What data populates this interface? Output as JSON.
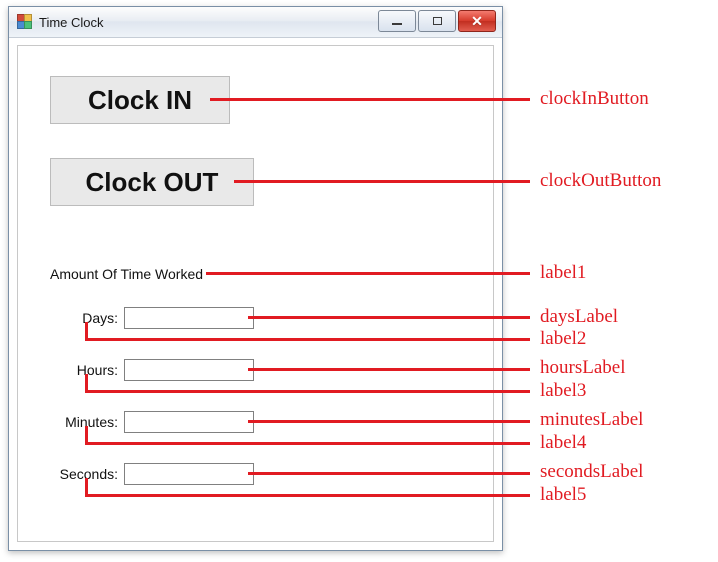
{
  "window": {
    "title": "Time Clock"
  },
  "buttons": {
    "clock_in": "Clock IN",
    "clock_out": "Clock OUT"
  },
  "section": {
    "amount_label": "Amount Of Time Worked"
  },
  "rows": {
    "days": {
      "label": "Days:",
      "value": ""
    },
    "hours": {
      "label": "Hours:",
      "value": ""
    },
    "minutes": {
      "label": "Minutes:",
      "value": ""
    },
    "seconds": {
      "label": "Seconds:",
      "value": ""
    }
  },
  "annotations": {
    "clockInButton": "clockInButton",
    "clockOutButton": "clockOutButton",
    "label1": "label1",
    "daysLabel": "daysLabel",
    "label2": "label2",
    "hoursLabel": "hoursLabel",
    "label3": "label3",
    "minutesLabel": "minutesLabel",
    "label4": "label4",
    "secondsLabel": "secondsLabel",
    "label5": "label5"
  },
  "colors": {
    "annotation": "#e11b22"
  }
}
